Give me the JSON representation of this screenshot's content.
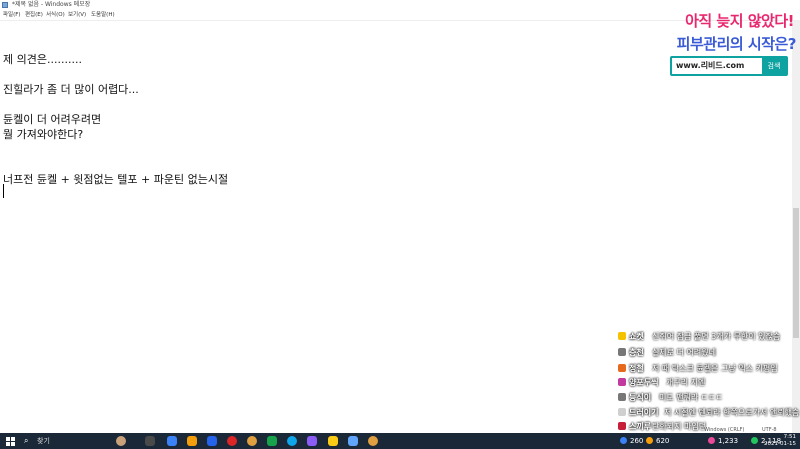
{
  "window": {
    "title": "*제목 없음 - Windows 메모장"
  },
  "menu": [
    "파일(F)",
    "편집(E)",
    "서식(O)",
    "보기(V)",
    "도움말(H)"
  ],
  "editor_lines": [
    "제 의견은..........",
    "진힐라가 좀 더 많이 어렵다...",
    "듄켈이 더 어려우려면",
    "뭘 가져와야한다?",
    "너프전 듄켈 + 윗점없는 텔포 + 파운틴 없는시절"
  ],
  "ad": {
    "line1": "아직 늦지 않았다!",
    "line2": "피부관리의 시작은?",
    "url": "www.리비드.com",
    "button": "검색"
  },
  "chat": [
    {
      "name": "쇼켓",
      "text": "신쥐어 잠금 풀면 3개가 무한이 있잖슴",
      "badge": "#f5c200"
    },
    {
      "name": "층천",
      "text": "실제로 더 어려웠네",
      "badge": "#777777"
    },
    {
      "name": "정철",
      "text": "저 때 탁스크 듄켈은 그냥 익스 키평임",
      "badge": "#e56a1e"
    },
    {
      "name": "양포두씩",
      "text": "개구리 지엔",
      "badge": "#c23a9f"
    },
    {
      "name": "등식이",
      "text": "미도 맨뤄라 ㄷㄷㄷ",
      "badge": "#777777"
    },
    {
      "name": "드러이기",
      "text": "저 시절엔 텐뢰라 한쪽으로가서 앤뢰했슴",
      "badge": "#cfcfcf"
    },
    {
      "name": "스끼루",
      "text": "탄화되지 마입던",
      "badge": "#c71f3a"
    }
  ],
  "taskbar": {
    "search_icon": "search-icon",
    "search_text": "찾기",
    "stats": [
      {
        "label": "260",
        "color": "#3b82f6"
      },
      {
        "label": "620",
        "color": "#f59e0b"
      },
      {
        "label": "1,233",
        "color": "#ec4899"
      },
      {
        "label": "2,118",
        "color": "#22c55e"
      }
    ],
    "encoding": "Windows (CRLF)",
    "utf": "UTF-8",
    "time": "7:51",
    "date": "2021-01-15"
  },
  "colors": {
    "ad_pink": "#e8286e",
    "ad_blue": "#3b5bd6",
    "ad_teal": "#0ea2a0",
    "taskbar": "#1b2838"
  }
}
